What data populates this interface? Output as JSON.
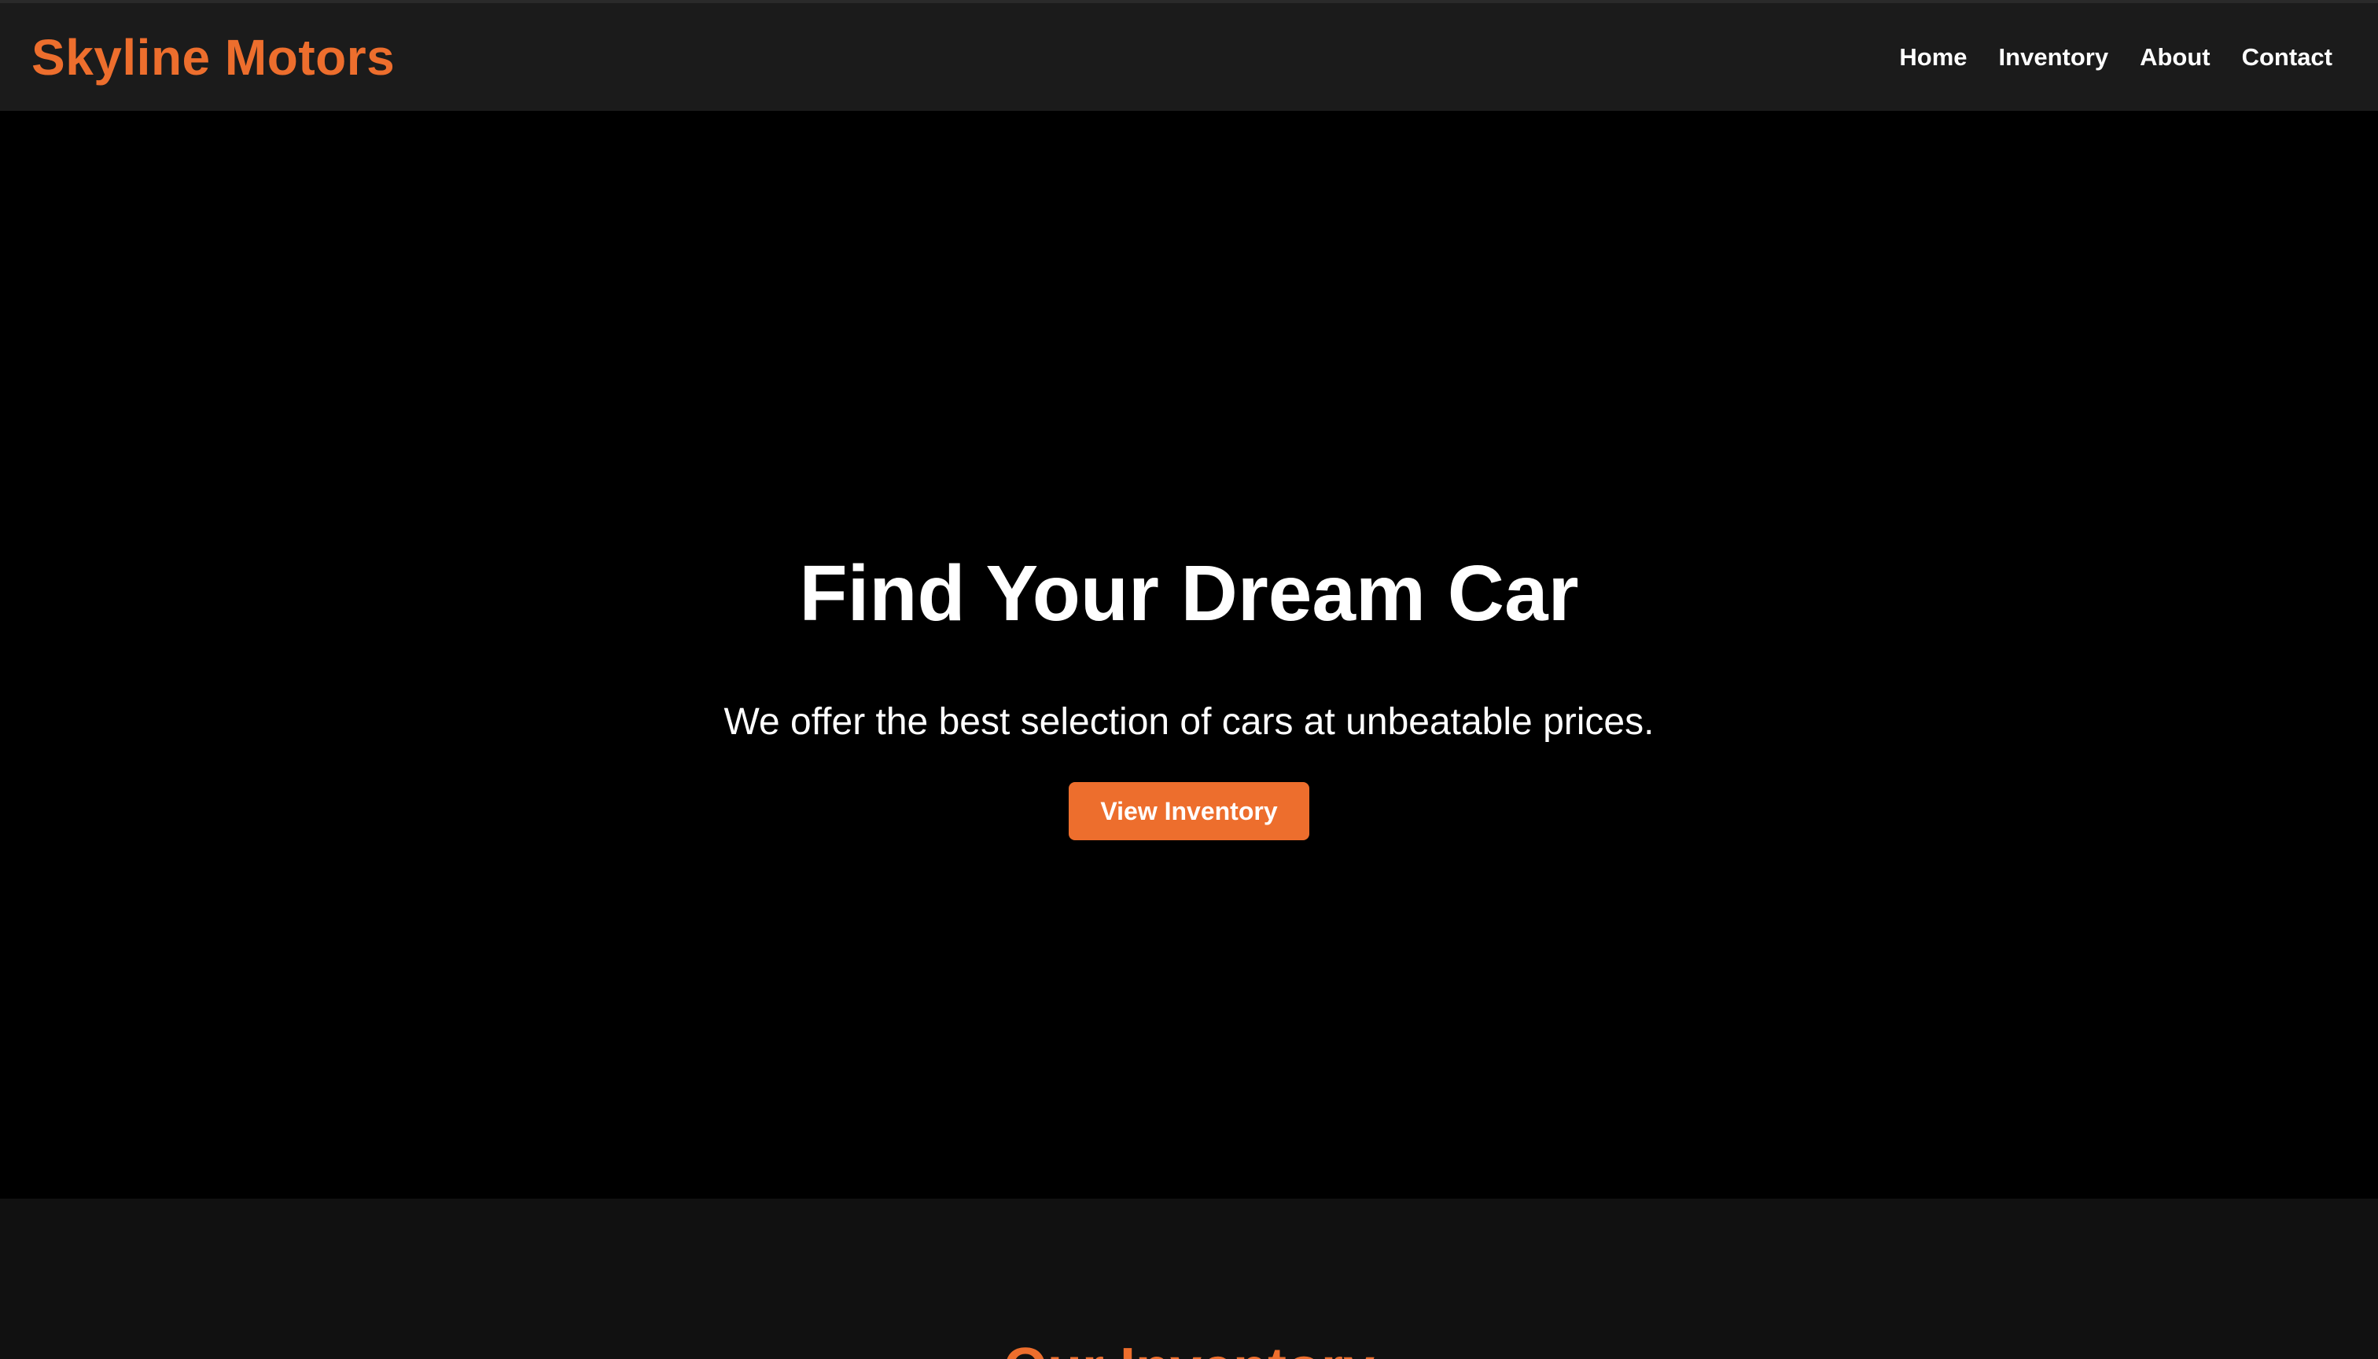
{
  "navbar": {
    "brand": "Skyline Motors",
    "links": [
      "Home",
      "Inventory",
      "About",
      "Contact"
    ]
  },
  "hero": {
    "title": "Find Your Dream Car",
    "subtitle": "We offer the best selection of cars at unbeatable prices.",
    "button_label": "View Inventory"
  },
  "next_section": {
    "heading": "Our Inventory"
  },
  "colors": {
    "accent": "#ed6e2d",
    "navbar_bg": "#1b1b1b",
    "hero_bg": "#000000",
    "section_bg": "#111111"
  }
}
